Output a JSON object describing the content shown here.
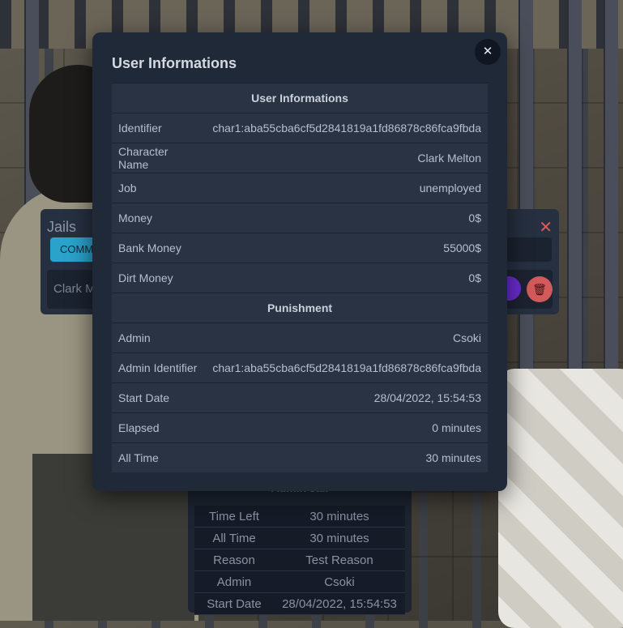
{
  "jails_panel": {
    "title": "Jails",
    "tab_label": "COMM",
    "row_name": "Clark M",
    "close_glyph": "✕",
    "delete_icon": "trash-icon"
  },
  "admin_jail": {
    "title": "Admin Jail",
    "rows": [
      {
        "key": "Time Left",
        "value": "30 minutes"
      },
      {
        "key": "All Time",
        "value": "30 minutes"
      },
      {
        "key": "Reason",
        "value": "Test Reason"
      },
      {
        "key": "Admin",
        "value": "Csoki"
      },
      {
        "key": "Start Date",
        "value": "28/04/2022, 15:54:53"
      }
    ]
  },
  "modal": {
    "title": "User Informations",
    "close_glyph": "✕",
    "sections": {
      "user": "User Informations",
      "punishment": "Punishment"
    },
    "user_rows": [
      {
        "key": "Identifier",
        "value": "char1:aba55cba6cf5d2841819a1fd86878c86fca9fbda"
      },
      {
        "key": "Character Name",
        "value": "Clark Melton"
      },
      {
        "key": "Job",
        "value": "unemployed"
      },
      {
        "key": "Money",
        "value": "0$"
      },
      {
        "key": "Bank Money",
        "value": "55000$"
      },
      {
        "key": "Dirt Money",
        "value": "0$"
      }
    ],
    "punishment_rows": [
      {
        "key": "Admin",
        "value": "Csoki"
      },
      {
        "key": "Admin Identifier",
        "value": "char1:aba55cba6cf5d2841819a1fd86878c86fca9fbda"
      },
      {
        "key": "Start Date",
        "value": "28/04/2022, 15:54:53"
      },
      {
        "key": "Elapsed",
        "value": "0 minutes"
      },
      {
        "key": "All Time",
        "value": "30 minutes"
      }
    ]
  }
}
